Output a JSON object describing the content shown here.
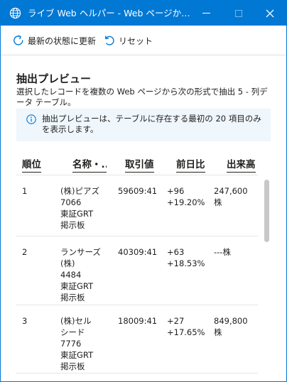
{
  "window": {
    "title": "ライブ Web ヘルパー - Web ページからデータを..."
  },
  "toolbar": {
    "refresh_label": "最新の状態に更新",
    "reset_label": "リセット"
  },
  "preview": {
    "title": "抽出プレビュー",
    "description": "選択したレコードを複数の Web ページから次の形式で抽出 5 - 列データ テーブル。",
    "info": "抽出プレビューは、テーブルに存在する最初の 20 項目のみを表示します。"
  },
  "table": {
    "headers": [
      "順位",
      "名称・...",
      "取引値",
      "前日比",
      "出来高"
    ],
    "rows": [
      {
        "rank": "1",
        "name": "(株)ピアズ\n7066\n東証GRT\n掲示板",
        "trade": "59609:41",
        "change": "+96\n+19.20%",
        "volume": "247,600\n株"
      },
      {
        "rank": "2",
        "name": "ランサーズ\n(株)\n4484\n東証GRT\n掲示板",
        "trade": "40309:41",
        "change": "+63\n+18.53%",
        "volume": "---株"
      },
      {
        "rank": "3",
        "name": "(株)セル\nシード\n7776\n東証GRT\n掲示板",
        "trade": "18009:41",
        "change": "+27\n+17.65%",
        "volume": "849,800\n株"
      }
    ]
  },
  "colors": {
    "title_bar": "#0078d4",
    "info_background": "#eff6fc"
  },
  "icons": {
    "app": "globe-icon",
    "refresh": "refresh-icon",
    "reset": "undo-icon",
    "info": "info-icon"
  }
}
